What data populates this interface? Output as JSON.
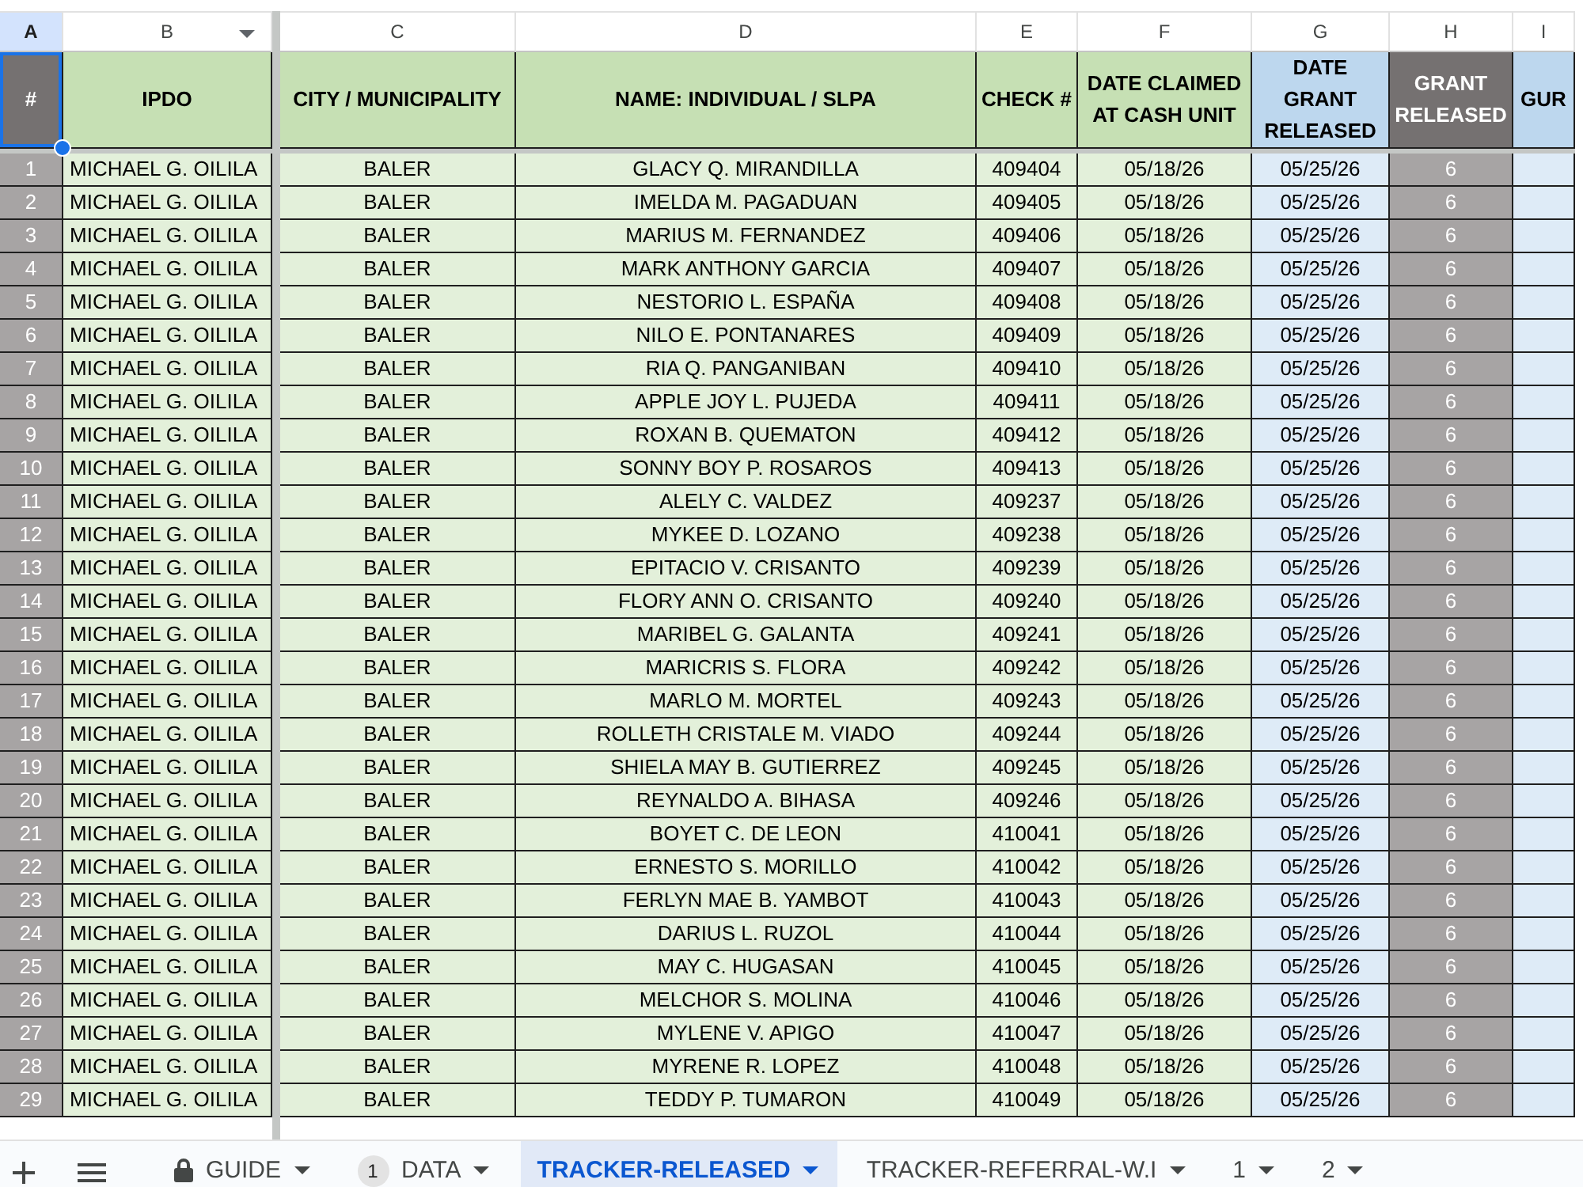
{
  "column_letters": [
    {
      "label": "A",
      "selected": true,
      "hovered": false
    },
    {
      "label": "B",
      "selected": false,
      "hovered": true
    },
    {
      "label": "C",
      "selected": false,
      "hovered": false
    },
    {
      "label": "D",
      "selected": false,
      "hovered": false
    },
    {
      "label": "E",
      "selected": false,
      "hovered": false
    },
    {
      "label": "F",
      "selected": false,
      "hovered": false
    },
    {
      "label": "G",
      "selected": false,
      "hovered": false
    },
    {
      "label": "H",
      "selected": false,
      "hovered": false
    },
    {
      "label": "I",
      "selected": false,
      "hovered": false
    }
  ],
  "columns": [
    {
      "label": "#",
      "kind": "counter",
      "color": "#757171",
      "selected": true
    },
    {
      "label": "IPDO",
      "kind": "tint",
      "color": "#c6e0b4",
      "selected": false
    },
    {
      "label": "CITY / MUNICIPALITY",
      "kind": "tint",
      "color": "#c6e0b4",
      "selected": false
    },
    {
      "label": "NAME: INDIVIDUAL / SLPA",
      "kind": "tint",
      "color": "#c6e0b4",
      "selected": false
    },
    {
      "label": "CHECK #",
      "kind": "tint",
      "color": "#c6e0b4",
      "selected": false
    },
    {
      "label": "DATE CLAIMED AT CASH UNIT",
      "kind": "tint",
      "color": "#c6e0b4",
      "selected": false
    },
    {
      "label": "DATE GRANT RELEASED",
      "kind": "tint",
      "color": "#bdd7ee",
      "selected": false
    },
    {
      "label": "GRANT RELEASED",
      "kind": "counter",
      "color": "#757171",
      "selected": false
    },
    {
      "label": "GUR",
      "kind": "tint",
      "color": "#bdd7ee",
      "selected": false
    }
  ],
  "rows": [
    [
      "1",
      "MICHAEL G. OILILA",
      "BALER",
      "GLACY Q. MIRANDILLA",
      "409404",
      "05/18/26",
      "05/25/26",
      "6"
    ],
    [
      "2",
      "MICHAEL G. OILILA",
      "BALER",
      "IMELDA M. PAGADUAN",
      "409405",
      "05/18/26",
      "05/25/26",
      "6"
    ],
    [
      "3",
      "MICHAEL G. OILILA",
      "BALER",
      "MARIUS M. FERNANDEZ",
      "409406",
      "05/18/26",
      "05/25/26",
      "6"
    ],
    [
      "4",
      "MICHAEL G. OILILA",
      "BALER",
      "MARK ANTHONY GARCIA",
      "409407",
      "05/18/26",
      "05/25/26",
      "6"
    ],
    [
      "5",
      "MICHAEL G. OILILA",
      "BALER",
      "NESTORIO L. ESPAÑA",
      "409408",
      "05/18/26",
      "05/25/26",
      "6"
    ],
    [
      "6",
      "MICHAEL G. OILILA",
      "BALER",
      "NILO E. PONTANARES",
      "409409",
      "05/18/26",
      "05/25/26",
      "6"
    ],
    [
      "7",
      "MICHAEL G. OILILA",
      "BALER",
      "RIA Q. PANGANIBAN",
      "409410",
      "05/18/26",
      "05/25/26",
      "6"
    ],
    [
      "8",
      "MICHAEL G. OILILA",
      "BALER",
      "APPLE JOY L. PUJEDA",
      "409411",
      "05/18/26",
      "05/25/26",
      "6"
    ],
    [
      "9",
      "MICHAEL G. OILILA",
      "BALER",
      "ROXAN B. QUEMATON",
      "409412",
      "05/18/26",
      "05/25/26",
      "6"
    ],
    [
      "10",
      "MICHAEL G. OILILA",
      "BALER",
      "SONNY BOY P. ROSAROS",
      "409413",
      "05/18/26",
      "05/25/26",
      "6"
    ],
    [
      "11",
      "MICHAEL G. OILILA",
      "BALER",
      "ALELY C. VALDEZ",
      "409237",
      "05/18/26",
      "05/25/26",
      "6"
    ],
    [
      "12",
      "MICHAEL G. OILILA",
      "BALER",
      "MYKEE D. LOZANO",
      "409238",
      "05/18/26",
      "05/25/26",
      "6"
    ],
    [
      "13",
      "MICHAEL G. OILILA",
      "BALER",
      "EPITACIO V. CRISANTO",
      "409239",
      "05/18/26",
      "05/25/26",
      "6"
    ],
    [
      "14",
      "MICHAEL G. OILILA",
      "BALER",
      "FLORY ANN O. CRISANTO",
      "409240",
      "05/18/26",
      "05/25/26",
      "6"
    ],
    [
      "15",
      "MICHAEL G. OILILA",
      "BALER",
      "MARIBEL G. GALANTA",
      "409241",
      "05/18/26",
      "05/25/26",
      "6"
    ],
    [
      "16",
      "MICHAEL G. OILILA",
      "BALER",
      "MARICRIS S. FLORA",
      "409242",
      "05/18/26",
      "05/25/26",
      "6"
    ],
    [
      "17",
      "MICHAEL G. OILILA",
      "BALER",
      "MARLO M. MORTEL",
      "409243",
      "05/18/26",
      "05/25/26",
      "6"
    ],
    [
      "18",
      "MICHAEL G. OILILA",
      "BALER",
      "ROLLETH CRISTALE M. VIADO",
      "409244",
      "05/18/26",
      "05/25/26",
      "6"
    ],
    [
      "19",
      "MICHAEL G. OILILA",
      "BALER",
      "SHIELA MAY B. GUTIERREZ",
      "409245",
      "05/18/26",
      "05/25/26",
      "6"
    ],
    [
      "20",
      "MICHAEL G. OILILA",
      "BALER",
      "REYNALDO A. BIHASA",
      "409246",
      "05/18/26",
      "05/25/26",
      "6"
    ],
    [
      "21",
      "MICHAEL G. OILILA",
      "BALER",
      "BOYET C. DE LEON",
      "410041",
      "05/18/26",
      "05/25/26",
      "6"
    ],
    [
      "22",
      "MICHAEL G. OILILA",
      "BALER",
      "ERNESTO S. MORILLO",
      "410042",
      "05/18/26",
      "05/25/26",
      "6"
    ],
    [
      "23",
      "MICHAEL G. OILILA",
      "BALER",
      "FERLYN MAE B. YAMBOT",
      "410043",
      "05/18/26",
      "05/25/26",
      "6"
    ],
    [
      "24",
      "MICHAEL G. OILILA",
      "BALER",
      "DARIUS L. RUZOL",
      "410044",
      "05/18/26",
      "05/25/26",
      "6"
    ],
    [
      "25",
      "MICHAEL G. OILILA",
      "BALER",
      "MAY C. HUGASAN",
      "410045",
      "05/18/26",
      "05/25/26",
      "6"
    ],
    [
      "26",
      "MICHAEL G. OILILA",
      "BALER",
      "MELCHOR S. MOLINA",
      "410046",
      "05/18/26",
      "05/25/26",
      "6"
    ],
    [
      "27",
      "MICHAEL G. OILILA",
      "BALER",
      "MYLENE V. APIGO",
      "410047",
      "05/18/26",
      "05/25/26",
      "6"
    ],
    [
      "28",
      "MICHAEL G. OILILA",
      "BALER",
      "MYRENE R. LOPEZ",
      "410048",
      "05/18/26",
      "05/25/26",
      "6"
    ],
    [
      "29",
      "MICHAEL G. OILILA",
      "BALER",
      "TEDDY P. TUMARON",
      "410049",
      "05/18/26",
      "05/25/26",
      "6"
    ]
  ],
  "sheet_tabs": [
    {
      "label": "GUIDE",
      "selected": false,
      "locked": true
    },
    {
      "label": "DATA",
      "selected": false,
      "locked": false,
      "badge": "1"
    },
    {
      "label": "TRACKER-RELEASED",
      "selected": true,
      "locked": false
    },
    {
      "label": "TRACKER-REFERRAL-W.I",
      "selected": false,
      "locked": false
    },
    {
      "label": "1",
      "selected": false,
      "locked": false
    },
    {
      "label": "2",
      "selected": false,
      "locked": false
    }
  ]
}
